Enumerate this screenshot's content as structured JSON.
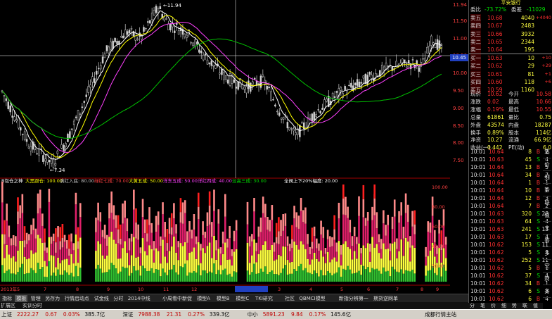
{
  "window_title": "平安银行",
  "price_axis": [
    "11.94",
    "11.50",
    "11.00",
    "10.50",
    "10.00",
    "9.50",
    "9.00",
    "8.50",
    "8.00",
    "7.50"
  ],
  "current_price_tag": "10.45",
  "hi_label": "11.94",
  "lo_label": "7.34",
  "indicator_header": [
    {
      "text": "B包仓之神",
      "color": "#ffffff"
    },
    {
      "text": "大黑跟仓: 100.00",
      "color": "#ffff00"
    },
    {
      "text": "满红入底: 80.00",
      "color": "#c0c0c0"
    },
    {
      "text": "绿红七成: 70.00",
      "color": "#ff4040"
    },
    {
      "text": "大黄五成: 50.00",
      "color": "#ffff00"
    },
    {
      "text": "洋东五成: 50.00",
      "color": "#ff40ff"
    },
    {
      "text": "洋红四成: 40.00",
      "color": "#ff40ff"
    },
    {
      "text": "淡高三成: 30.00",
      "color": "#00e000"
    },
    {
      "text": "全阀上下20%幅度: 20.00",
      "color": "#ffffff"
    }
  ],
  "indicator_axis": [
    "100.00",
    "80.00",
    "60.00",
    "40.00",
    "20.00"
  ],
  "date_axis": [
    "2013年5",
    "7",
    "8",
    "9",
    "10",
    "11",
    "12",
    "2014/01/15/三",
    "3",
    "4",
    "5",
    "6",
    "7",
    "8",
    "9"
  ],
  "date_corner": "日线",
  "tabs": [
    "指标",
    "模板",
    "管理",
    "另存为",
    "行情启动点",
    "试金线",
    "分时",
    "2014中线",
    "小周看中新促",
    "模型A",
    "模型B",
    "模型C",
    "TKI研究",
    "社区",
    "QBMCI模型",
    "新指分辨第一",
    "期货逆网单"
  ],
  "subtabs": [
    "扩展区",
    "实训分时"
  ],
  "side_tabs": [
    "笔",
    "价",
    "细",
    "势",
    "联",
    "值",
    "主",
    "筹",
    "多",
    "空",
    "财",
    "务"
  ],
  "quote": {
    "wei_bi_label": "委比",
    "wei_bi": "-73.72%",
    "wei_cha_label": "委差",
    "wei_cha": "-11029",
    "asks": [
      {
        "label": "卖五",
        "price": "10.68",
        "vol": "4040",
        "chg": "+4040"
      },
      {
        "label": "卖四",
        "price": "10.67",
        "vol": "2483",
        "chg": ""
      },
      {
        "label": "卖三",
        "price": "10.66",
        "vol": "3932",
        "chg": ""
      },
      {
        "label": "卖二",
        "price": "10.65",
        "vol": "2344",
        "chg": ""
      },
      {
        "label": "卖一",
        "price": "10.64",
        "vol": "195",
        "chg": ""
      }
    ],
    "bids": [
      {
        "label": "买一",
        "price": "10.63",
        "vol": "10",
        "chg": "+10"
      },
      {
        "label": "买二",
        "price": "10.62",
        "vol": "29",
        "chg": "+29"
      },
      {
        "label": "买三",
        "price": "10.61",
        "vol": "81",
        "chg": "+1"
      },
      {
        "label": "买四",
        "price": "10.60",
        "vol": "118",
        "chg": "+6"
      },
      {
        "label": "买五",
        "price": "10.59",
        "vol": "1160",
        "chg": ""
      }
    ],
    "stats": [
      {
        "l1": "现价",
        "v1": "10.62",
        "l2": "今开",
        "v2": "10.58"
      },
      {
        "l1": "涨跌",
        "v1": "0.02",
        "l2": "最高",
        "v2": "10.66"
      },
      {
        "l1": "涨幅",
        "v1": "0.19%",
        "l2": "最低",
        "v2": "10.55"
      },
      {
        "l1": "总量",
        "v1": "61861",
        "l2": "量比",
        "v2": "0.75"
      },
      {
        "l1": "外盘",
        "v1": "43574",
        "l2": "内盘",
        "v2": "18287"
      },
      {
        "l1": "换手",
        "v1": "0.89%",
        "l2": "股本",
        "v2": "114亿"
      },
      {
        "l1": "净资",
        "v1": "10.27",
        "l2": "流通",
        "v2": "66.9亿"
      },
      {
        "l1": "收益(一)",
        "v1": "0.442",
        "l2": "PE(动)",
        "v2": "6.0"
      }
    ]
  },
  "ticks": [
    {
      "t": "10:01",
      "p": "10.64",
      "v": "8",
      "s": "B",
      "n": "2"
    },
    {
      "t": "10:01",
      "p": "10.63",
      "v": "45",
      "s": "S",
      "n": "4"
    },
    {
      "t": "10:01",
      "p": "10.64",
      "v": "13",
      "s": "B",
      "n": "5"
    },
    {
      "t": "10:01",
      "p": "10.64",
      "v": "34",
      "s": "B",
      "n": "7"
    },
    {
      "t": "10:01",
      "p": "10.64",
      "v": "1",
      "s": "B",
      "n": "1"
    },
    {
      "t": "10:01",
      "p": "10.64",
      "v": "10",
      "s": "B",
      "n": "1"
    },
    {
      "t": "10:01",
      "p": "10.64",
      "v": "12",
      "s": "B",
      "n": "3"
    },
    {
      "t": "10:01",
      "p": "10.64",
      "v": "7",
      "s": "B",
      "n": "2"
    },
    {
      "t": "10:01",
      "p": "10.63",
      "v": "320",
      "s": "S",
      "n": "28"
    },
    {
      "t": "10:01",
      "p": "10.63",
      "v": "64",
      "s": "S",
      "n": "4"
    },
    {
      "t": "10:01",
      "p": "10.63",
      "v": "241",
      "s": "S",
      "n": "13"
    },
    {
      "t": "10:01",
      "p": "10.63",
      "v": "17",
      "s": "S",
      "n": "4"
    },
    {
      "t": "10:01",
      "p": "10.62",
      "v": "153",
      "s": "S",
      "n": "11"
    },
    {
      "t": "10:01",
      "p": "10.62",
      "v": "5",
      "s": "S",
      "n": "3"
    },
    {
      "t": "10:01",
      "p": "10.62",
      "v": "252",
      "s": "S",
      "n": "11"
    },
    {
      "t": "10:01",
      "p": "10.62",
      "v": "5",
      "s": "B",
      "n": "1"
    },
    {
      "t": "10:01",
      "p": "10.62",
      "v": "37",
      "s": "S",
      "n": "4"
    },
    {
      "t": "10:01",
      "p": "10.62",
      "v": "34",
      "s": "B",
      "n": "1"
    },
    {
      "t": "10:01",
      "p": "10.62",
      "v": "6",
      "s": "S",
      "n": "3"
    },
    {
      "t": "10:01",
      "p": "10.62",
      "v": "6",
      "s": "B",
      "n": "4"
    }
  ],
  "ticks_tabs": [
    "分",
    "笔",
    "价",
    "细",
    "势",
    "联",
    "值"
  ],
  "status": [
    {
      "text": "上证",
      "color": "#000000"
    },
    {
      "text": "2222.27",
      "color": "#c00000"
    },
    {
      "text": "0.67",
      "color": "#c00000"
    },
    {
      "text": "0.03%",
      "color": "#c00000"
    },
    {
      "text": "385.7亿",
      "color": "#000000"
    },
    {
      "text": "深证",
      "color": "#000000"
    },
    {
      "text": "7988.38",
      "color": "#c00000"
    },
    {
      "text": "21.31",
      "color": "#c00000"
    },
    {
      "text": "0.27%",
      "color": "#c00000"
    },
    {
      "text": "339.3亿",
      "color": "#000000"
    },
    {
      "text": "中小",
      "color": "#000000"
    },
    {
      "text": "5891.23",
      "color": "#c00000"
    },
    {
      "text": "9.84",
      "color": "#c00000"
    },
    {
      "text": "0.17%",
      "color": "#c00000"
    },
    {
      "text": "145.6亿",
      "color": "#000000"
    },
    {
      "text": "成都行情主站",
      "color": "#000000"
    }
  ]
}
